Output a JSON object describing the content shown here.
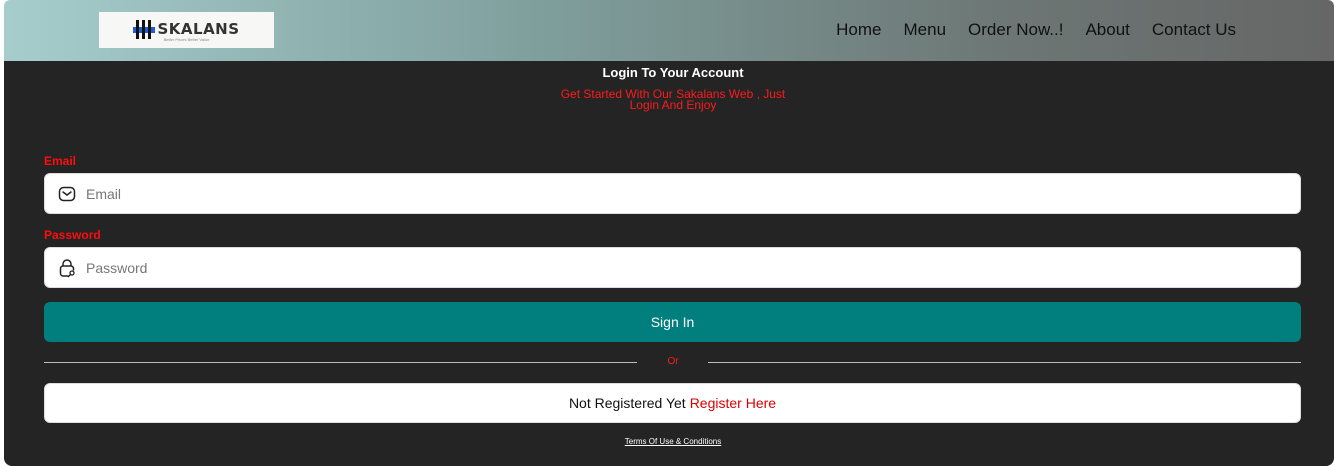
{
  "nav": {
    "logo_text": "SKALANS",
    "logo_tagline": "Better Prices Better Value",
    "links": [
      "Home",
      "Menu",
      "Order Now..!",
      "About",
      "Contact Us"
    ]
  },
  "login": {
    "title": "Login To Your Account",
    "subtitle": "Get Started With Our Sakalans Web , Just Login And Enjoy",
    "email_label": "Email",
    "email_placeholder": "Email",
    "password_label": "Password",
    "password_placeholder": "Password",
    "signin_label": "Sign In",
    "or_text": "Or",
    "register_prefix": "Not Registered Yet",
    "register_link": "Register Here",
    "terms": "Terms Of Use & Conditions"
  },
  "colors": {
    "accent": "#017e7e",
    "panel_bg": "#242424",
    "label_red": "#ff0d0d"
  },
  "icons": {
    "email": "mail-icon",
    "password": "lock-icon"
  }
}
